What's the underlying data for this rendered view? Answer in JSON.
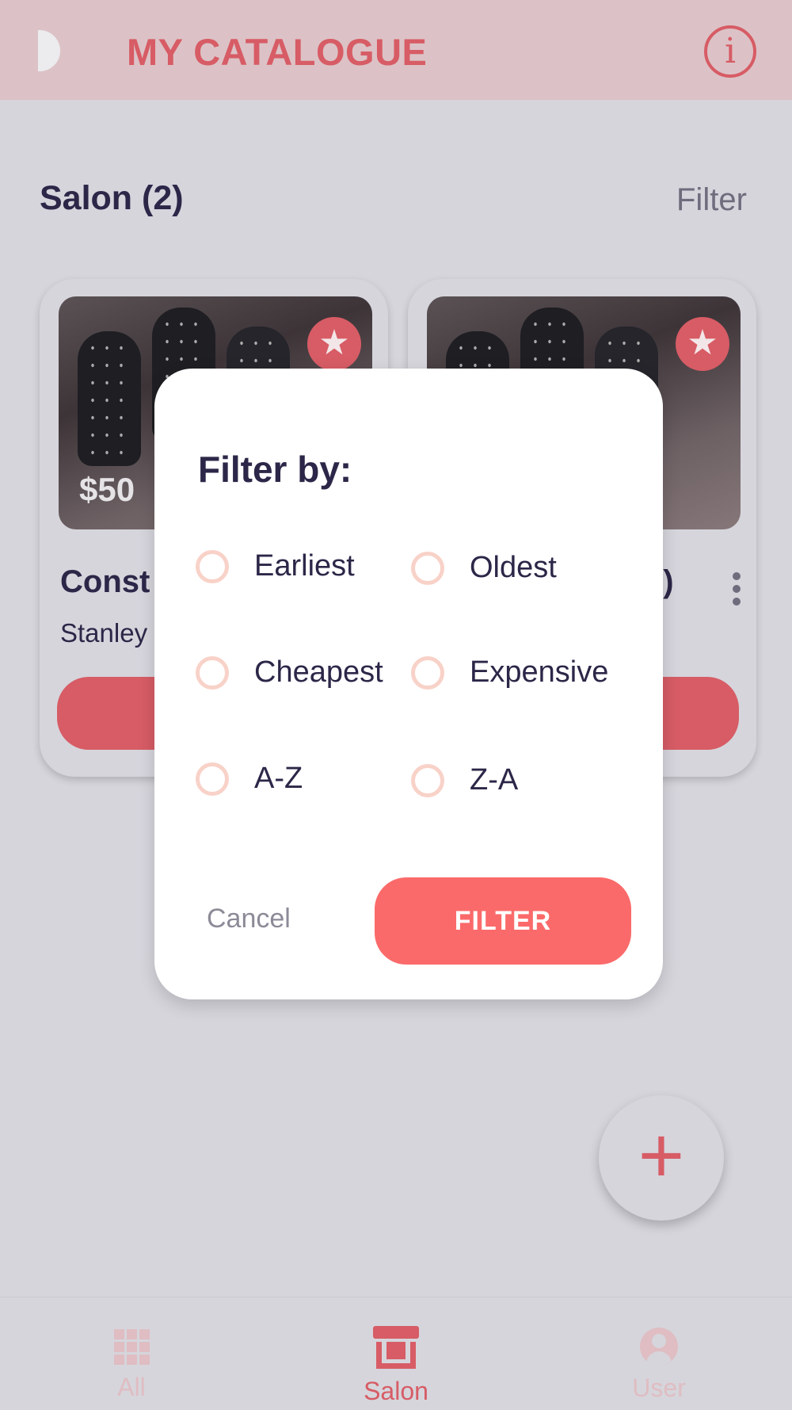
{
  "header": {
    "title": "MY CATALOGUE",
    "info_glyph": "i"
  },
  "section": {
    "title": "Salon (2)",
    "filter_label": "Filter"
  },
  "cards": [
    {
      "price": "$50",
      "name": "Const",
      "artist": "Stanley",
      "icon": "star-icon"
    },
    {
      "name_suffix": "2)",
      "icon": "star-icon"
    }
  ],
  "modal": {
    "title": "Filter by:",
    "options": [
      "Earliest",
      "Oldest",
      "Cheapest",
      "Expensive",
      "A-Z",
      "Z-A"
    ],
    "cancel_label": "Cancel",
    "filter_label": "FILTER"
  },
  "fab": {
    "label": "+"
  },
  "bottom_nav": {
    "items": [
      {
        "label": "All",
        "icon": "grid-icon",
        "active": false
      },
      {
        "label": "Salon",
        "icon": "store-icon",
        "active": true
      },
      {
        "label": "User",
        "icon": "user-icon",
        "active": false
      }
    ]
  },
  "colors": {
    "accent": "#d75c65",
    "header_bg": "#dcc2c6",
    "page_bg": "#d6d5dc",
    "filter_button": "#fb6a6a",
    "radio_ring": "#f8d2c8",
    "text_dark": "#2c2748"
  }
}
